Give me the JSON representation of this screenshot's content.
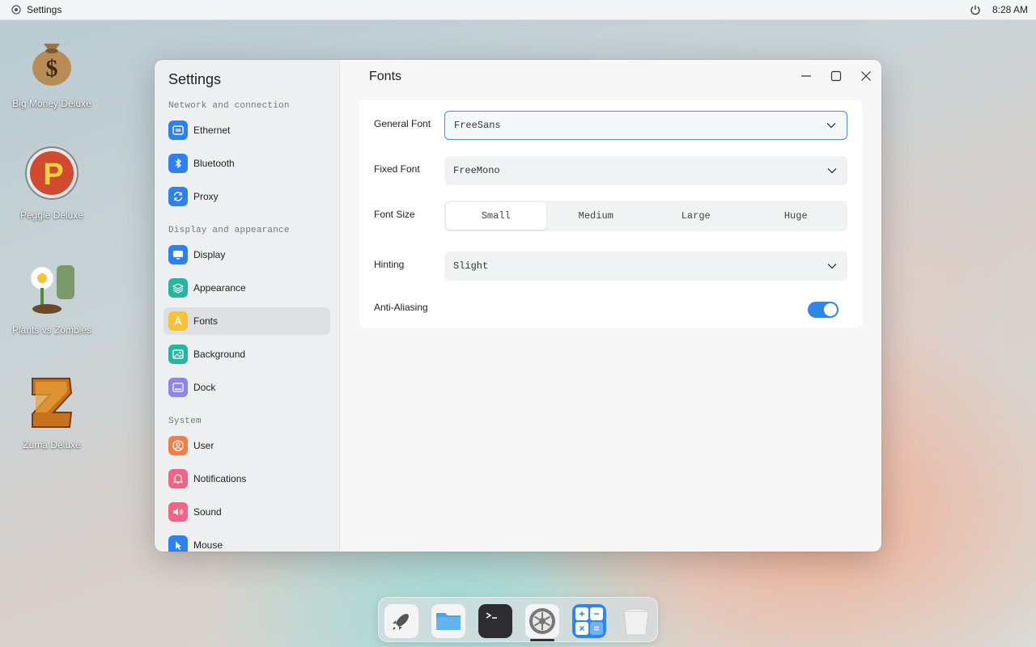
{
  "topbar": {
    "app_title": "Settings",
    "time": "8:28 AM",
    "app_icon": "settings-icon",
    "power_icon": "power-icon"
  },
  "desktop_icons": [
    {
      "label": "Big Money Deluxe",
      "icon": "money-bag-icon"
    },
    {
      "label": "Peggle Deluxe",
      "icon": "peggle-icon"
    },
    {
      "label": "Plants vs Zombies",
      "icon": "plants-vs-zombies-icon"
    },
    {
      "label": "Zuma Deluxe",
      "icon": "zuma-icon"
    }
  ],
  "window": {
    "sidebar_title": "Settings",
    "sections": [
      {
        "title": "Network and connection",
        "items": [
          {
            "label": "Ethernet",
            "icon": "ethernet-icon",
            "color": "#2f80ed"
          },
          {
            "label": "Bluetooth",
            "icon": "bluetooth-icon",
            "color": "#2f80ed"
          },
          {
            "label": "Proxy",
            "icon": "proxy-icon",
            "color": "#2f80ed"
          }
        ]
      },
      {
        "title": "Display and appearance",
        "items": [
          {
            "label": "Display",
            "icon": "display-icon",
            "color": "#2f80ed"
          },
          {
            "label": "Appearance",
            "icon": "appearance-icon",
            "color": "#26b5a0"
          },
          {
            "label": "Fonts",
            "icon": "fonts-icon",
            "color": "#f5c33b",
            "active": true
          },
          {
            "label": "Background",
            "icon": "background-icon",
            "color": "#26b5a0"
          },
          {
            "label": "Dock",
            "icon": "dock-icon",
            "color": "#8f86e8"
          }
        ]
      },
      {
        "title": "System",
        "items": [
          {
            "label": "User",
            "icon": "user-icon",
            "color": "#ef7f4b"
          },
          {
            "label": "Notifications",
            "icon": "notifications-icon",
            "color": "#ee6585"
          },
          {
            "label": "Sound",
            "icon": "sound-icon",
            "color": "#ee6585"
          },
          {
            "label": "Mouse",
            "icon": "mouse-icon",
            "color": "#2f80ed"
          }
        ]
      }
    ],
    "page_title": "Fonts",
    "controls": {
      "minimize": "minimize-icon",
      "maximize": "maximize-icon",
      "close": "close-icon"
    },
    "fonts": {
      "general_font": {
        "label": "General Font",
        "value": "FreeSans"
      },
      "fixed_font": {
        "label": "Fixed Font",
        "value": "FreeMono"
      },
      "font_size": {
        "label": "Font Size",
        "options": [
          "Small",
          "Medium",
          "Large",
          "Huge"
        ],
        "selected": "Small"
      },
      "hinting": {
        "label": "Hinting",
        "value": "Slight"
      },
      "anti_aliasing": {
        "label": "Anti-Aliasing",
        "enabled": true
      }
    },
    "accent_color": "#2f86e6"
  },
  "dock": {
    "items": [
      {
        "name": "launcher",
        "icon": "rocket-icon"
      },
      {
        "name": "files",
        "icon": "folder-icon"
      },
      {
        "name": "terminal",
        "icon": "terminal-icon"
      },
      {
        "name": "settings",
        "icon": "settings-icon",
        "running": true
      },
      {
        "name": "calculator",
        "icon": "calculator-icon"
      },
      {
        "name": "trash",
        "icon": "trash-icon"
      }
    ]
  }
}
